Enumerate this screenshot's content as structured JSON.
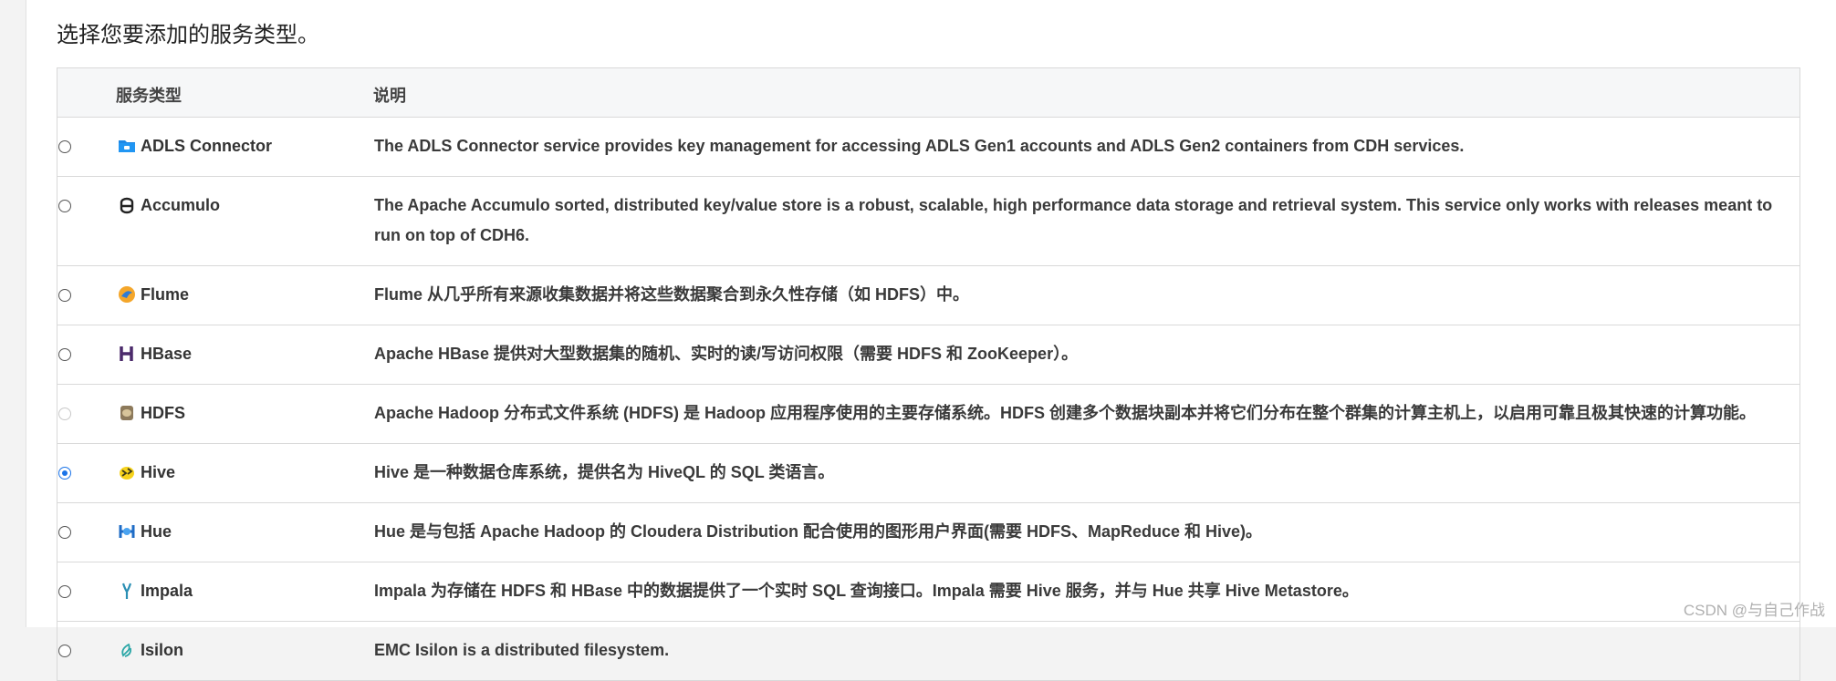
{
  "prompt": "选择您要添加的服务类型。",
  "table": {
    "headers": {
      "type": "服务类型",
      "description": "说明"
    },
    "rows": [
      {
        "name": "ADLS Connector",
        "icon": "adls-folder-icon",
        "selected": false,
        "disabled": false,
        "description": "The ADLS Connector service provides key management for accessing ADLS Gen1 accounts and ADLS Gen2 containers from CDH services."
      },
      {
        "name": "Accumulo",
        "icon": "accumulo-icon",
        "selected": false,
        "disabled": false,
        "description": "The Apache Accumulo sorted, distributed key/value store is a robust, scalable, high performance data storage and retrieval system. This service only works with releases meant to run on top of CDH6."
      },
      {
        "name": "Flume",
        "icon": "flume-icon",
        "selected": false,
        "disabled": false,
        "description": "Flume 从几乎所有来源收集数据并将这些数据聚合到永久性存储（如 HDFS）中。"
      },
      {
        "name": "HBase",
        "icon": "hbase-icon",
        "selected": false,
        "disabled": false,
        "description": "Apache HBase 提供对大型数据集的随机、实时的读/写访问权限（需要 HDFS 和 ZooKeeper）。"
      },
      {
        "name": "HDFS",
        "icon": "hdfs-icon",
        "selected": false,
        "disabled": true,
        "description": "Apache Hadoop 分布式文件系统 (HDFS) 是 Hadoop 应用程序使用的主要存储系统。HDFS 创建多个数据块副本并将它们分布在整个群集的计算主机上，以启用可靠且极其快速的计算功能。"
      },
      {
        "name": "Hive",
        "icon": "hive-bee-icon",
        "selected": true,
        "disabled": false,
        "description": "Hive 是一种数据仓库系统，提供名为 HiveQL 的 SQL 类语言。"
      },
      {
        "name": "Hue",
        "icon": "hue-icon",
        "selected": false,
        "disabled": false,
        "description": "Hue 是与包括 Apache Hadoop 的 Cloudera Distribution 配合使用的图形用户界面(需要 HDFS、MapReduce 和 Hive)。"
      },
      {
        "name": "Impala",
        "icon": "impala-icon",
        "selected": false,
        "disabled": false,
        "description": "Impala 为存储在 HDFS 和 HBase 中的数据提供了一个实时 SQL 查询接口。Impala 需要 Hive 服务，并与 Hue 共享 Hive Metastore。"
      },
      {
        "name": "Isilon",
        "icon": "isilon-icon",
        "selected": false,
        "disabled": false,
        "description": "EMC Isilon is a distributed filesystem."
      }
    ]
  },
  "watermark": "CSDN @与自己作战",
  "colors": {
    "accent": "#1a73e8",
    "header_bg": "#f6f7f8",
    "border": "#d9d9d9"
  }
}
